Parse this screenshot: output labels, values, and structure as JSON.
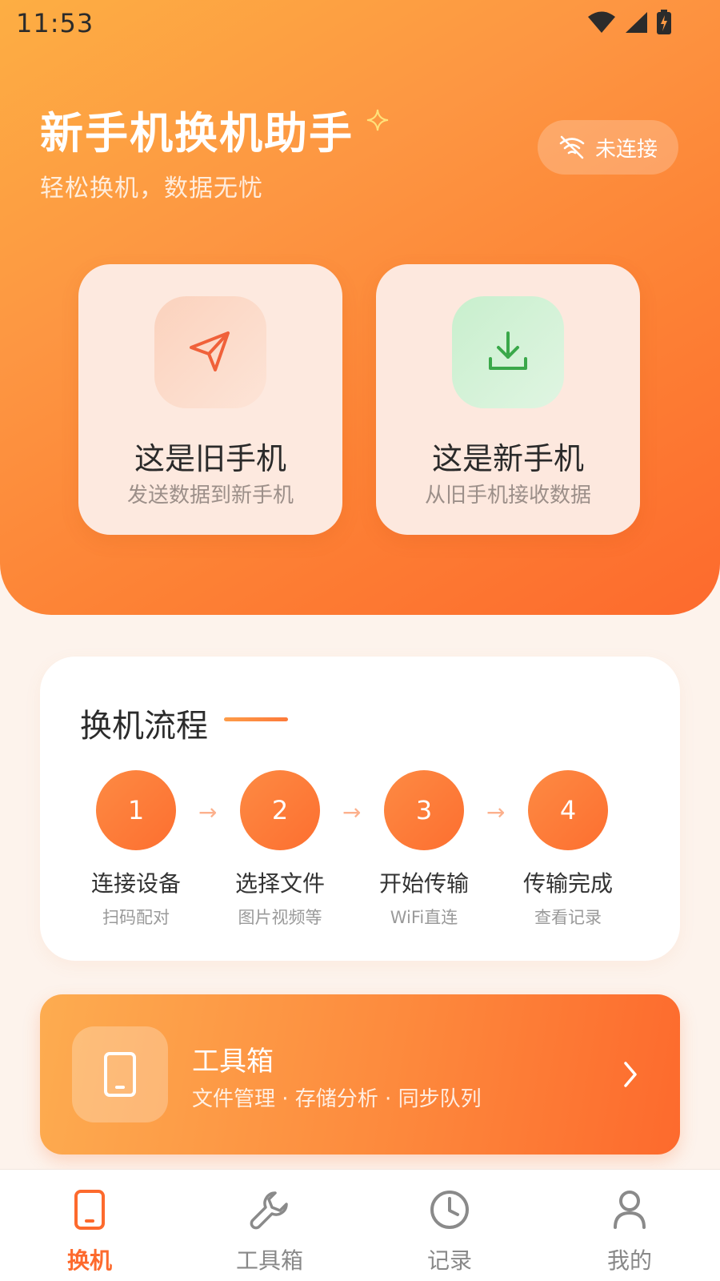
{
  "status_bar": {
    "time": "11:53"
  },
  "header": {
    "title": "新手机换机助手",
    "subtitle": "轻松换机，数据无忧",
    "connection_status": "未连接"
  },
  "roles": [
    {
      "title": "这是旧手机",
      "subtitle": "发送数据到新手机",
      "icon": "send-icon"
    },
    {
      "title": "这是新手机",
      "subtitle": "从旧手机接收数据",
      "icon": "download-icon"
    }
  ],
  "flow": {
    "title": "换机流程",
    "steps": [
      {
        "number": "1",
        "label": "连接设备",
        "sub": "扫码配对"
      },
      {
        "number": "2",
        "label": "选择文件",
        "sub": "图片视频等"
      },
      {
        "number": "3",
        "label": "开始传输",
        "sub": "WiFi直连"
      },
      {
        "number": "4",
        "label": "传输完成",
        "sub": "查看记录"
      }
    ]
  },
  "toolbox": {
    "title": "工具箱",
    "subtitle": "文件管理 · 存储分析 · 同步队列"
  },
  "tabs": [
    {
      "label": "换机",
      "icon": "phone-icon",
      "active": true
    },
    {
      "label": "工具箱",
      "icon": "wrench-icon",
      "active": false
    },
    {
      "label": "记录",
      "icon": "clock-icon",
      "active": false
    },
    {
      "label": "我的",
      "icon": "person-icon",
      "active": false
    }
  ],
  "colors": {
    "accent": "#fd6a2d",
    "hero_start": "#fdae43",
    "hero_end": "#fd6a2d",
    "download_green": "#3aa84a"
  }
}
